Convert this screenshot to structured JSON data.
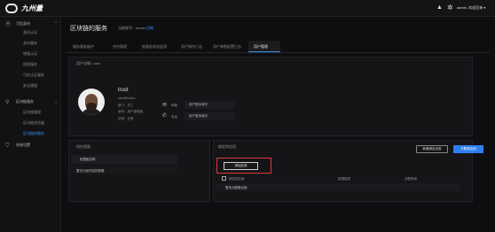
{
  "header": {
    "brand": "九州量",
    "user_label": "admin, 欢迎回来 ▾"
  },
  "sidebar": {
    "items": [
      {
        "label": "可信身份",
        "icon": "fingerprint-icon",
        "type": "group"
      },
      {
        "label": "身份认证",
        "type": "item"
      },
      {
        "label": "身份服务",
        "type": "item"
      },
      {
        "label": "增强认证",
        "type": "item"
      },
      {
        "label": "权限服务",
        "type": "item"
      },
      {
        "label": "可信认证服务",
        "type": "item"
      },
      {
        "label": "安全通道",
        "type": "item"
      },
      {
        "label": "区块链服务",
        "icon": "link-icon",
        "type": "group"
      },
      {
        "label": "区块链管理",
        "type": "item"
      },
      {
        "label": "区块链浏览器",
        "type": "item"
      },
      {
        "label": "区块链的服务",
        "type": "item",
        "active": true
      },
      {
        "label": "系统设置",
        "icon": "shield-icon",
        "type": "group"
      }
    ]
  },
  "page": {
    "title": "区块链的服务",
    "owner_prefix": "当前账号：admin",
    "owner_link": "切换",
    "tabs": [
      "服务基础维护",
      "合约管理",
      "链服务状态监测",
      "用户操作日志",
      "用户参数配置日志",
      "用户管理"
    ],
    "active_tab": 5
  },
  "profile": {
    "section_title": "用户详情 / user",
    "name": "trust",
    "identifier": "identification",
    "dept": "部门：员工",
    "role": "身份：用户管理者",
    "status": "状态：正常",
    "email_label": "邮箱",
    "email_value": "用户暂未填写",
    "phone_label": "电话",
    "phone_value": "用户暂未填写"
  },
  "permissions": {
    "title": "所在权限",
    "rows": [
      "权限组名称",
      "暂无已经开启的权限"
    ]
  },
  "apps": {
    "title": "绑定的应用",
    "new_button": "新增绑定应用",
    "primary_button": "分配新应用",
    "inner_button": "添加应用",
    "columns": [
      "绑定的应用",
      "权限描述",
      "分配时间"
    ],
    "empty_row": "暂未分配新应用"
  },
  "colors": {
    "accent": "#2f7ef0",
    "highlight_border": "#d8383b"
  }
}
